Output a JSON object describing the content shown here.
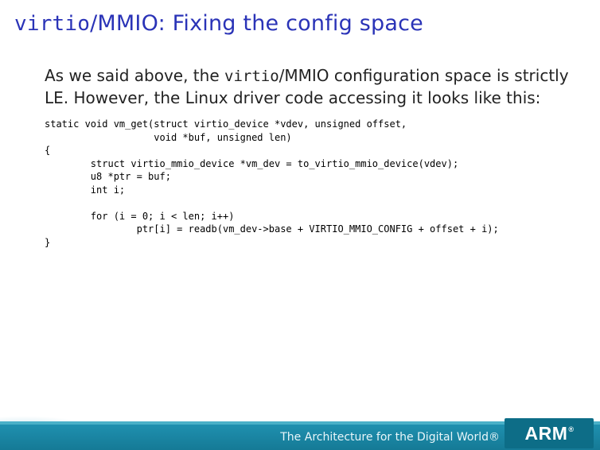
{
  "title": {
    "tt": "virtio",
    "plain1": "/MMIO",
    "plain2": ": Fixing the config space"
  },
  "body": {
    "line1a": "As we said above, the ",
    "line1tt": "virtio",
    "line1b": "/MMIO configuration space is strictly",
    "line2": "LE. However, the Linux driver code accessing it looks like this:"
  },
  "code": "static void vm_get(struct virtio_device *vdev, unsigned offset,\n                   void *buf, unsigned len)\n{\n        struct virtio_mmio_device *vm_dev = to_virtio_mmio_device(vdev);\n        u8 *ptr = buf;\n        int i;\n\n        for (i = 0; i < len; i++)\n                ptr[i] = readb(vm_dev->base + VIRTIO_MMIO_CONFIG + offset + i);\n}",
  "footer": {
    "tagline": "The Architecture for the Digital World®",
    "logo_text": "ARM",
    "logo_reg": "®"
  }
}
